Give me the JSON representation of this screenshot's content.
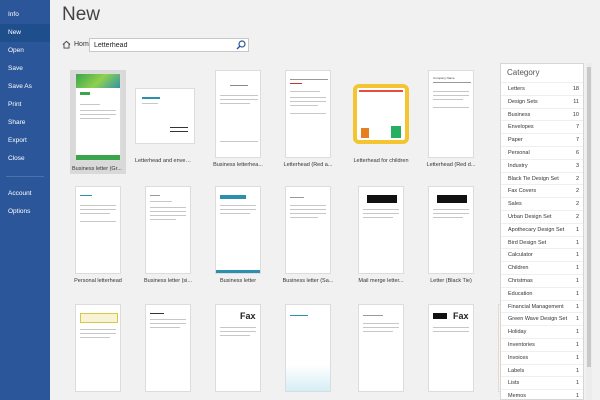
{
  "sidebar": {
    "items": [
      {
        "label": "Info"
      },
      {
        "label": "New"
      },
      {
        "label": "Open"
      },
      {
        "label": "Save"
      },
      {
        "label": "Save As"
      },
      {
        "label": "Print"
      },
      {
        "label": "Share"
      },
      {
        "label": "Export"
      },
      {
        "label": "Close"
      },
      {
        "label": "Account"
      },
      {
        "label": "Options"
      }
    ]
  },
  "header": {
    "title": "New"
  },
  "search": {
    "home_label": "Home",
    "value": "Letterhead"
  },
  "templates": [
    {
      "label": "Business letter (Gr...",
      "selected": true
    },
    {
      "label": "Letterhead and envelope"
    },
    {
      "label": "Business letterhea..."
    },
    {
      "label": "Letterhead (Red a..."
    },
    {
      "label": "Letterhead for children"
    },
    {
      "label": "Letterhead (Red d..."
    },
    {
      "label": "Personal letterhead"
    },
    {
      "label": "Business letter (si..."
    },
    {
      "label": "Business letter"
    },
    {
      "label": "Business letter (Sa..."
    },
    {
      "label": "Mail merge letter..."
    },
    {
      "label": "Letter (Black Tie)"
    },
    {
      "label": ""
    },
    {
      "label": ""
    },
    {
      "label": ""
    },
    {
      "label": ""
    },
    {
      "label": ""
    },
    {
      "label": ""
    }
  ],
  "category": {
    "title": "Category",
    "items": [
      {
        "name": "Letters",
        "count": "18"
      },
      {
        "name": "Design Sets",
        "count": "11"
      },
      {
        "name": "Business",
        "count": "10"
      },
      {
        "name": "Envelopes",
        "count": "7"
      },
      {
        "name": "Paper",
        "count": "7"
      },
      {
        "name": "Personal",
        "count": "6"
      },
      {
        "name": "Industry",
        "count": "3"
      },
      {
        "name": "Black Tie Design Set",
        "count": "2"
      },
      {
        "name": "Fax Covers",
        "count": "2"
      },
      {
        "name": "Sales",
        "count": "2"
      },
      {
        "name": "Urban Design Set",
        "count": "2"
      },
      {
        "name": "Apothecary Design Set",
        "count": "1"
      },
      {
        "name": "Bird Design Set",
        "count": "1"
      },
      {
        "name": "Calculator",
        "count": "1"
      },
      {
        "name": "Children",
        "count": "1"
      },
      {
        "name": "Christmas",
        "count": "1"
      },
      {
        "name": "Education",
        "count": "1"
      },
      {
        "name": "Financial Management",
        "count": "1"
      },
      {
        "name": "Green Wave Design Set",
        "count": "1"
      },
      {
        "name": "Holiday",
        "count": "1"
      },
      {
        "name": "Inventories",
        "count": "1"
      },
      {
        "name": "Invoices",
        "count": "1"
      },
      {
        "name": "Labels",
        "count": "1"
      },
      {
        "name": "Lists",
        "count": "1"
      },
      {
        "name": "Memos",
        "count": "1"
      }
    ]
  },
  "thumb_text": {
    "fax": "Fax",
    "company_name": "Company Name"
  },
  "colors": {
    "sidebar_bg": "#2b579a",
    "sidebar_active": "#1e4e8c",
    "accent_green": "#3aa54a",
    "accent_teal": "#2b8fb0",
    "accent_red": "#c0392b",
    "frame_yellow": "#f4c531"
  }
}
